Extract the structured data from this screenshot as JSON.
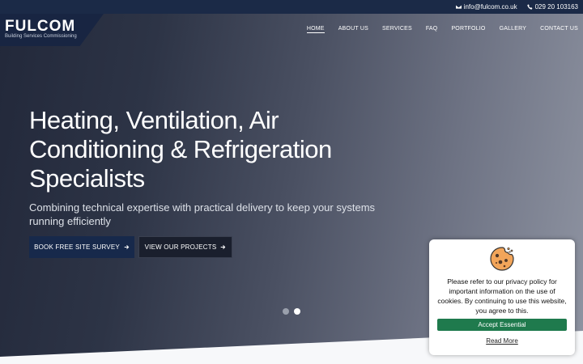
{
  "topbar": {
    "email": "info@fulcom.co.uk",
    "phone": "029 20 103163"
  },
  "logo": {
    "name": "FULCOM",
    "tagline": "Building Services Commissioning"
  },
  "nav": {
    "items": [
      {
        "label": "HOME",
        "active": true
      },
      {
        "label": "ABOUT US"
      },
      {
        "label": "SERVICES"
      },
      {
        "label": "FAQ"
      },
      {
        "label": "PORTFOLIO"
      },
      {
        "label": "GALLERY"
      },
      {
        "label": "CONTACT US"
      }
    ]
  },
  "hero": {
    "headline_line1": "Heating, Ventilation, Air",
    "headline_line2": "Conditioning & Refrigeration",
    "headline_line3": "Specialists",
    "subline": "Combining technical expertise with practical delivery to keep your systems running efficiently",
    "primary_button": "BOOK FREE SITE SURVEY",
    "secondary_button": "VIEW OUR PROJECTS",
    "slide_active": 2,
    "slide_count": 2
  },
  "cookie": {
    "message": "Please refer to our privacy policy for important information on the use of cookies. By continuing to use this website, you agree to this.",
    "accept_label": "Accept Essential",
    "read_more_label": "Read More"
  },
  "colors": {
    "navy": "#1b2a47",
    "accept_green": "#1f7a4d"
  }
}
